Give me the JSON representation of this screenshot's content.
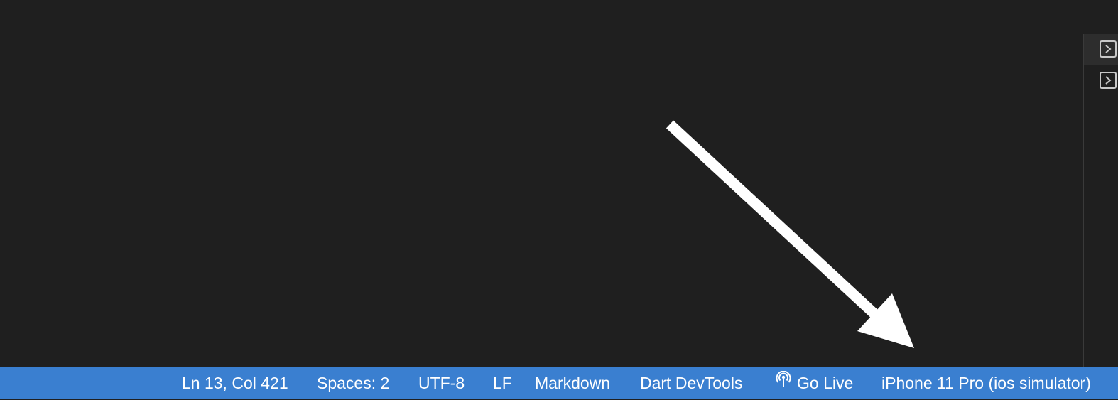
{
  "colors": {
    "statusbar_bg": "#3a7fd0",
    "editor_bg": "#1f1f1f",
    "arrow": "#ffffff"
  },
  "statusbar": {
    "cursor_position": "Ln 13, Col 421",
    "indentation": "Spaces: 2",
    "encoding": "UTF-8",
    "line_ending": "LF",
    "language_mode": "Markdown",
    "dart_devtools": "Dart DevTools",
    "go_live": {
      "label": "Go Live",
      "icon": "broadcast-icon"
    },
    "device": "iPhone 11 Pro (ios simulator)"
  },
  "right_panel": {
    "items": [
      {
        "icon": "terminal-icon",
        "active": true
      },
      {
        "icon": "terminal-icon",
        "active": false
      }
    ]
  }
}
